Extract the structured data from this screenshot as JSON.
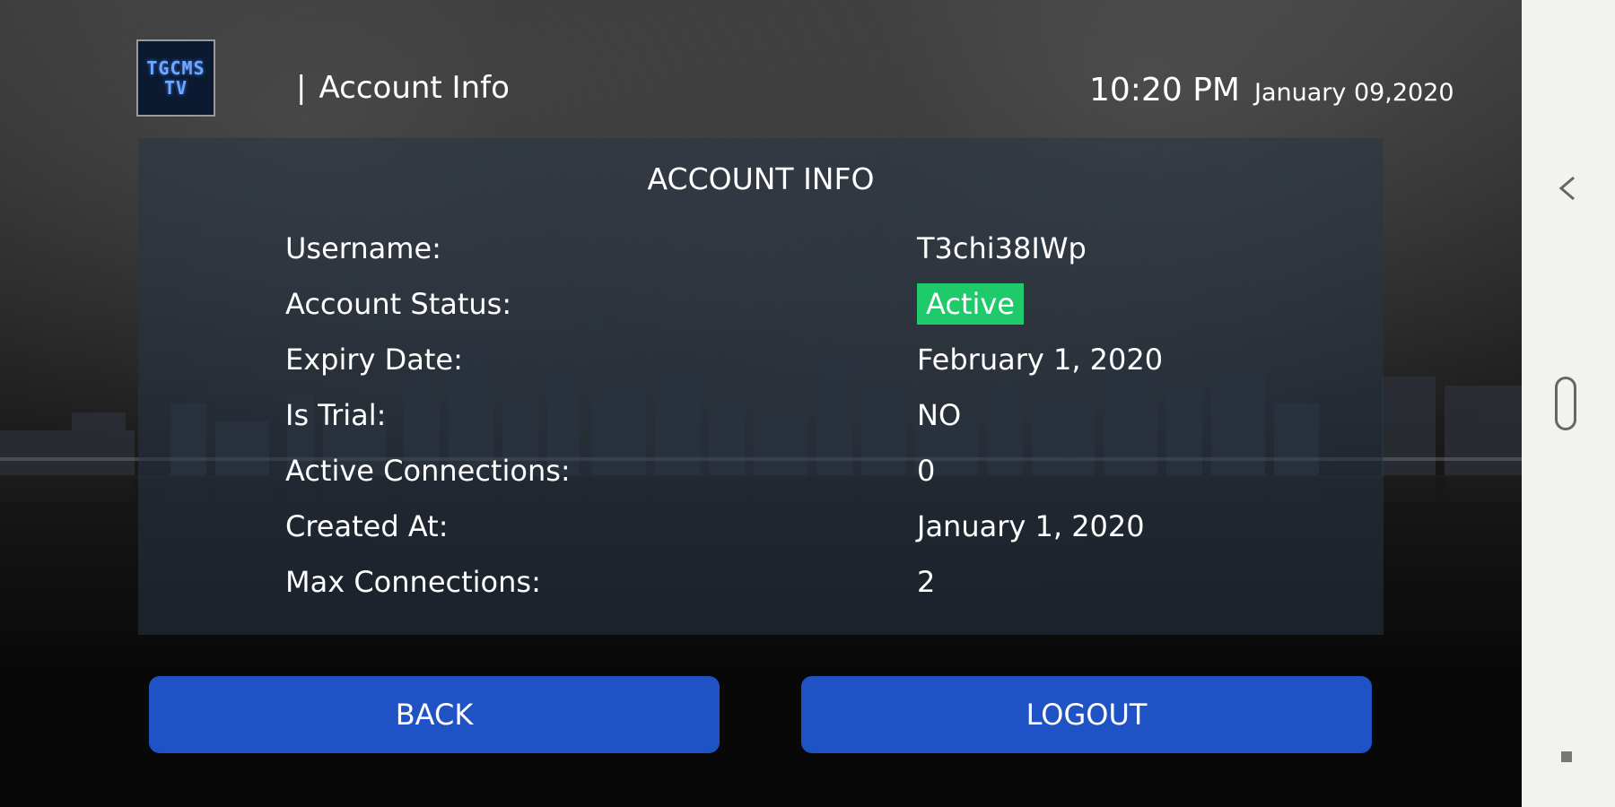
{
  "header": {
    "logo_line1": "TGCMS",
    "logo_line2": "TV",
    "separator": "|",
    "title": "Account Info",
    "time": "10:20 PM",
    "date": "January 09,2020"
  },
  "panel": {
    "heading": "ACCOUNT INFO",
    "rows": [
      {
        "label": "Username:",
        "value": "T3chi38IWp"
      },
      {
        "label": "Account Status:",
        "value": "Active"
      },
      {
        "label": "Expiry Date:",
        "value": "February 1, 2020"
      },
      {
        "label": "Is Trial:",
        "value": "NO"
      },
      {
        "label": "Active Connections:",
        "value": "0"
      },
      {
        "label": "Created At:",
        "value": "January 1, 2020"
      },
      {
        "label": "Max Connections:",
        "value": "2"
      }
    ]
  },
  "buttons": {
    "back": "BACK",
    "logout": "LOGOUT"
  },
  "colors": {
    "button_blue": "#1f52c4",
    "status_active_green": "#1fca6a",
    "navbar_bg": "#f2f2ee"
  },
  "icons": {
    "nav_back": "chevron-left-icon",
    "nav_home": "home-pill-icon",
    "nav_recent": "recent-apps-icon"
  }
}
